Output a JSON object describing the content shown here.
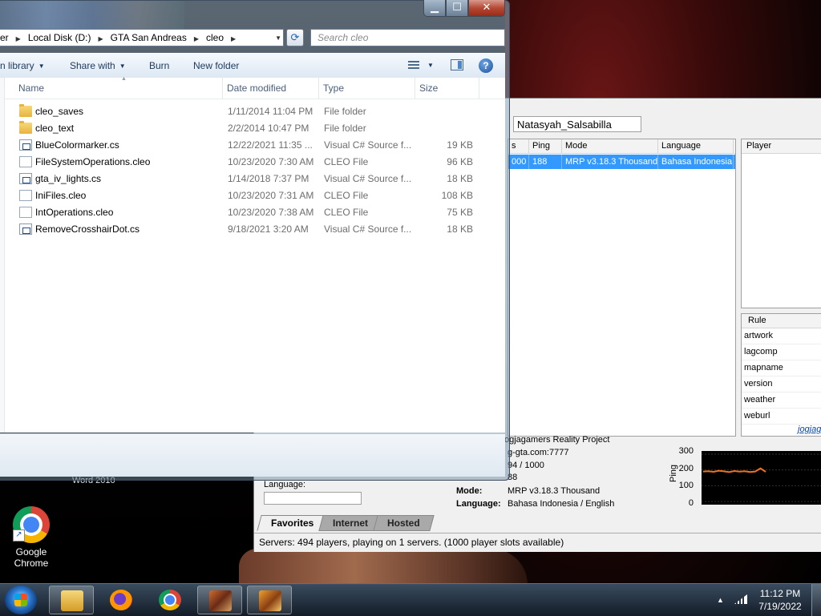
{
  "explorer": {
    "breadcrumbs": [
      "er",
      "Local Disk (D:)",
      "GTA San Andreas",
      "cleo"
    ],
    "search_placeholder": "Search cleo",
    "window_buttons": {
      "minimize": "▁",
      "maximize": "☐",
      "close": "✕"
    },
    "toolbar": {
      "include_library": "n library",
      "share_with": "Share with",
      "burn": "Burn",
      "new_folder": "New folder"
    },
    "columns": {
      "name": "Name",
      "date": "Date modified",
      "type": "Type",
      "size": "Size"
    },
    "files": [
      {
        "icon": "folder-icon",
        "name": "cleo_saves",
        "date": "1/11/2014 11:04 PM",
        "type": "File folder",
        "size": ""
      },
      {
        "icon": "folder-icon",
        "name": "cleo_text",
        "date": "2/2/2014 10:47 PM",
        "type": "File folder",
        "size": ""
      },
      {
        "icon": "csharp-file-icon",
        "name": "BlueColormarker.cs",
        "date": "12/22/2021 11:35 ...",
        "type": "Visual C# Source f...",
        "size": "19 KB"
      },
      {
        "icon": "cleo-file-icon",
        "name": "FileSystemOperations.cleo",
        "date": "10/23/2020 7:30 AM",
        "type": "CLEO File",
        "size": "96 KB"
      },
      {
        "icon": "csharp-file-icon",
        "name": "gta_iv_lights.cs",
        "date": "1/14/2018 7:37 PM",
        "type": "Visual C# Source f...",
        "size": "18 KB"
      },
      {
        "icon": "cleo-file-icon",
        "name": "IniFiles.cleo",
        "date": "10/23/2020 7:31 AM",
        "type": "CLEO File",
        "size": "108 KB"
      },
      {
        "icon": "cleo-file-icon",
        "name": "IntOperations.cleo",
        "date": "10/23/2020 7:38 AM",
        "type": "CLEO File",
        "size": "75 KB"
      },
      {
        "icon": "csharp-file-icon",
        "name": "RemoveCrosshairDot.cs",
        "date": "9/18/2021 3:20 AM",
        "type": "Visual C# Source f...",
        "size": "18 KB"
      }
    ]
  },
  "samp": {
    "player_name": "Natasyah_Salsabilla",
    "server_columns": {
      "players": "s",
      "ping": "Ping",
      "mode": "Mode",
      "language": "Language"
    },
    "server_row": {
      "players": "000",
      "ping": "188",
      "mode": "MRP v3.18.3 Thousand",
      "language": "Bahasa Indonesia"
    },
    "player_col": "Player",
    "rule_col": "Rule",
    "rules": [
      "artwork",
      "lagcomp",
      "mapname",
      "version",
      "weather",
      "weburl"
    ],
    "rule_link": "jogjag",
    "info": {
      "server_name": "ogjagamers Reality Project",
      "address": "g-gta.com:7777",
      "players": "94 / 1000",
      "ping": "88",
      "mode_label": "Mode:",
      "mode_value": "MRP v3.18.3 Thousand",
      "language_label": "Language:",
      "language_value": "Bahasa Indonesia / English"
    },
    "filter_language_label": "Language:",
    "ping_chart": {
      "ylabel": "Ping",
      "ticks": [
        "300",
        "200",
        "100",
        "0"
      ]
    },
    "tabs": [
      "Favorites",
      "Internet",
      "Hosted"
    ],
    "status": "Servers: 494 players, playing on 1 servers. (1000 player slots available)"
  },
  "chart_data": {
    "type": "line",
    "ylabel": "Ping",
    "ylim": [
      0,
      300
    ],
    "series": [
      {
        "values": [
          190,
          192,
          188,
          195,
          191,
          186,
          193,
          189,
          192,
          187,
          190,
          210,
          188
        ]
      }
    ]
  },
  "desktop": {
    "word_label": "Word 2010",
    "chrome_label_1": "Google",
    "chrome_label_2": "Chrome"
  },
  "taskbar": {
    "time": "11:12 PM",
    "date": "7/19/2022"
  }
}
